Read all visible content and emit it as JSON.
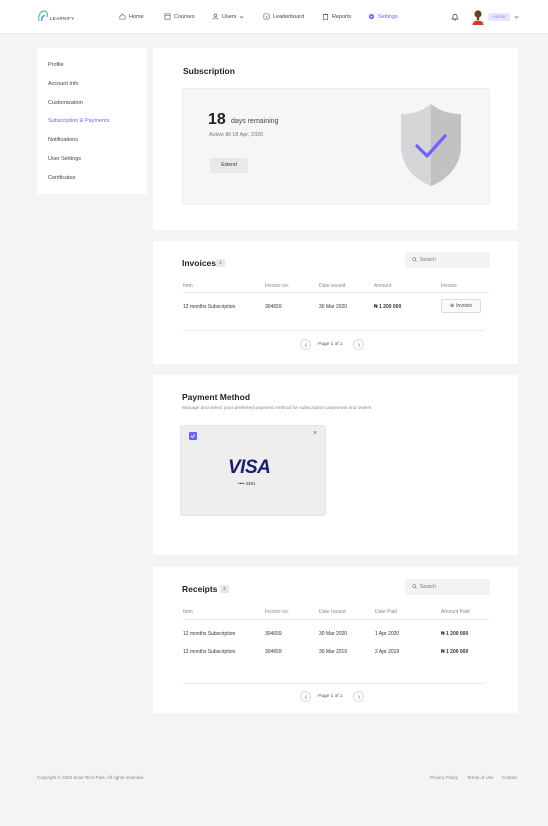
{
  "brand": {
    "logo_text": "LEARNIFY"
  },
  "nav": {
    "items": [
      {
        "label": "Home",
        "icon": "home-icon"
      },
      {
        "label": "Courses",
        "icon": "book-icon"
      },
      {
        "label": "Users",
        "icon": "user-icon"
      },
      {
        "label": "Leaderboard",
        "icon": "leaderboard-icon"
      },
      {
        "label": "Reports",
        "icon": "clipboard-icon"
      },
      {
        "label": "Settings",
        "icon": "gear-icon",
        "active": true
      }
    ],
    "admin_label": "Admin",
    "accent": "#6c63ff"
  },
  "sidebar": {
    "items": [
      {
        "label": "Profile"
      },
      {
        "label": "Account Info"
      },
      {
        "label": "Customization"
      },
      {
        "label": "Subscription & Payments",
        "active": true
      },
      {
        "label": "Notifications"
      },
      {
        "label": "User Settings"
      },
      {
        "label": "Certificates"
      }
    ]
  },
  "subscription": {
    "title": "Subscription",
    "days": "18",
    "days_label": "days remaining",
    "active_till": "Active till 18 Apr, 2020",
    "extend_label": "Extend"
  },
  "invoices": {
    "title": "Invoices",
    "count": "1",
    "search_placeholder": "Search",
    "columns": [
      "Item",
      "Invoice no.",
      "Date issued",
      "Amount",
      "Invoice"
    ],
    "rows": [
      {
        "item": "12 months Subscription",
        "invoice_no": "304659",
        "date": "30 Mar 2020",
        "amount": "₦ 1 200 000",
        "action": "Invoice"
      }
    ],
    "pagination": "Page 1 of 1"
  },
  "payment": {
    "title": "Payment Method",
    "subtitle": "Manage and select your preferred payment method for subscription payments and orders.",
    "card_brand": "VISA",
    "card_last": "•••• 4491",
    "close": "×"
  },
  "receipts": {
    "title": "Receipts",
    "count": "2",
    "search_placeholder": "Search",
    "columns": [
      "Item",
      "Invoice no.",
      "Date Issued",
      "Date Paid",
      "Amount Paid"
    ],
    "rows": [
      {
        "item": "12 months Subscription",
        "invoice_no": "304659",
        "date_issued": "30 Mar 2020",
        "date_paid": "1 Apr 2020",
        "amount": "₦ 1 200 000"
      },
      {
        "item": "12 months Subscription",
        "invoice_no": "304659",
        "date_issued": "30 Mar 2019",
        "date_paid": "2 Apr 2019",
        "amount": "₦ 1 200 000"
      }
    ],
    "pagination": "Page 1 of 1"
  },
  "footer": {
    "copyright": "Copyright © 2020 Zone Tech Park. All rights reserved.",
    "links": [
      "Privacy Policy",
      "Terms of Use",
      "Contact"
    ]
  }
}
